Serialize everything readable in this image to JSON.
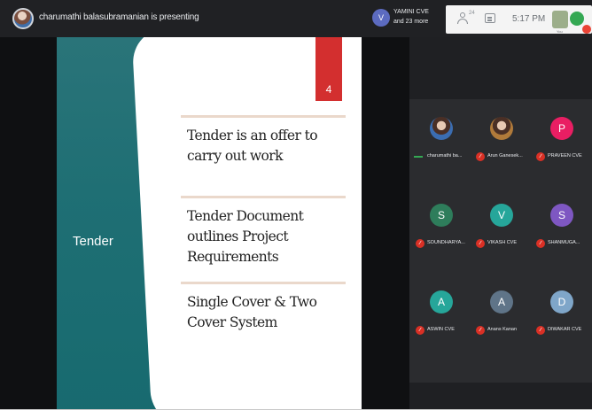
{
  "topbar": {
    "presenting_text": "charumathi balasubramanian is presenting",
    "participant_chip": {
      "initial": "V",
      "line1": "YAMINI CVE",
      "line2": "and 23 more"
    },
    "tray": {
      "people_count": "24",
      "time": "5:17 PM",
      "me_label": "You"
    }
  },
  "slide": {
    "panel_title": "Tender",
    "slide_number": "4",
    "bullets": [
      "Tender is an offer to carry out work",
      "Tender Document outlines Project Requirements",
      "Single Cover & Two Cover System"
    ],
    "colors": {
      "panel": "#1f6f74",
      "number_badge": "#d32f2f",
      "rule": "#ead8cb"
    }
  },
  "gallery": {
    "tiles": [
      {
        "name": "charumathi ba...",
        "initial": "",
        "color": "#3b6db1",
        "photo": true,
        "muted": false
      },
      {
        "name": "Arun Ganesek...",
        "initial": "",
        "color": "#b07a3a",
        "photo": true,
        "muted": true
      },
      {
        "name": "PRAVEEN CVE",
        "initial": "P",
        "color": "#e91e63",
        "photo": false,
        "muted": true
      },
      {
        "name": "SOUNDHARYA...",
        "initial": "S",
        "color": "#2e7d5b",
        "photo": false,
        "muted": true
      },
      {
        "name": "VIKASH CVE",
        "initial": "V",
        "color": "#26a69a",
        "photo": false,
        "muted": true
      },
      {
        "name": "SHANMUGA...",
        "initial": "S",
        "color": "#7e57c2",
        "photo": false,
        "muted": true
      },
      {
        "name": "ASWIN CVE",
        "initial": "A",
        "color": "#26a69a",
        "photo": false,
        "muted": true
      },
      {
        "name": "Anans Kanan",
        "initial": "A",
        "color": "#5f7488",
        "photo": false,
        "muted": true
      },
      {
        "name": "DIWAKAR CVE",
        "initial": "D",
        "color": "#7fa6c9",
        "photo": false,
        "muted": true
      }
    ]
  }
}
